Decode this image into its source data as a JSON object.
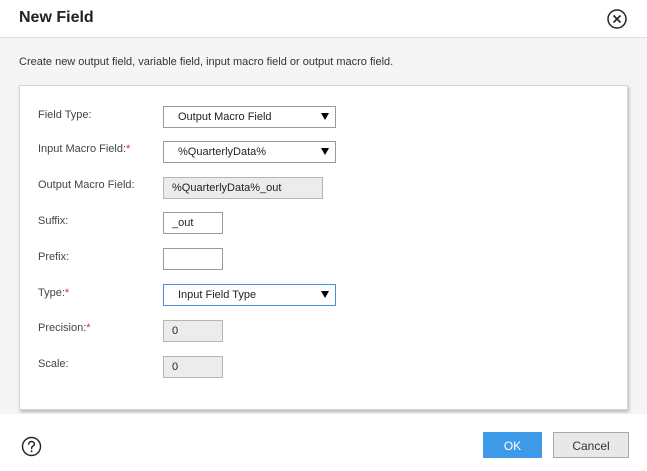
{
  "dialog": {
    "title": "New Field",
    "description": "Create new output field, variable field, input macro field or output macro field."
  },
  "form": {
    "field_type": {
      "label": "Field Type:",
      "value": "Output Macro Field"
    },
    "input_macro_field": {
      "label": "Input Macro Field:",
      "required": "*",
      "value": "%QuarterlyData%"
    },
    "output_macro_field": {
      "label": "Output Macro Field:",
      "value": "%QuarterlyData%_out"
    },
    "suffix": {
      "label": "Suffix:",
      "value": "_out"
    },
    "prefix": {
      "label": "Prefix:",
      "value": ""
    },
    "type": {
      "label": "Type:",
      "required": "*",
      "value": "Input Field Type"
    },
    "precision": {
      "label": "Precision:",
      "required": "*",
      "value": "0"
    },
    "scale": {
      "label": "Scale:",
      "value": "0"
    }
  },
  "footer": {
    "ok_label": "OK",
    "cancel_label": "Cancel"
  },
  "icons": {
    "close": "close-circle-icon",
    "help": "help-circle-icon"
  },
  "colors": {
    "ok_button": "#3d9ae8",
    "required_marker": "#d32f2f",
    "focus_border": "#4a90d9"
  }
}
